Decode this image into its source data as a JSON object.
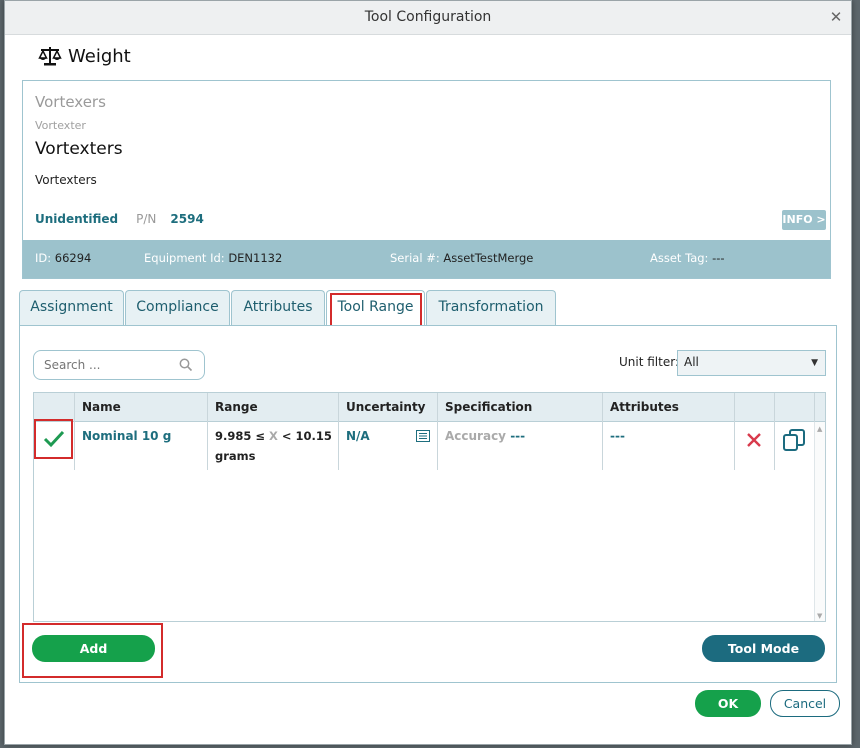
{
  "dialog": {
    "title": "Tool Configuration"
  },
  "heading": "Weight",
  "asset": {
    "manufacturer": "Vortexers",
    "manufacturer_sub": "Vortexter",
    "model": "Vortexters",
    "description": "Vortexters",
    "status": "Unidentified",
    "pn_label": "P/N",
    "pn_value": "2594",
    "info_button": "INFO >",
    "id_label": "ID:",
    "id_value": "66294",
    "equipment_label": "Equipment Id:",
    "equipment_value": "DEN1132",
    "serial_label": "Serial #:",
    "serial_value": "AssetTestMerge",
    "tag_label": "Asset Tag:",
    "tag_value": "---"
  },
  "tabs": [
    "Assignment",
    "Compliance",
    "Attributes",
    "Tool Range",
    "Transformation"
  ],
  "active_tab": "Tool Range",
  "search": {
    "placeholder": "Search ..."
  },
  "unit_filter": {
    "label": "Unit filter:",
    "value": "All"
  },
  "table": {
    "headers": [
      "Name",
      "Range",
      "Uncertainty",
      "Specification",
      "Attributes"
    ],
    "rows": [
      {
        "name": "Nominal 10 g",
        "range_low": "9.985 ≤ ",
        "range_x": "X",
        "range_high": " < 10.15",
        "range_unit": "grams",
        "uncertainty": "N/A",
        "spec_label": "Accuracy",
        "spec_value": " ---",
        "attributes": "---"
      }
    ]
  },
  "buttons": {
    "add": "Add",
    "tool_mode": "Tool Mode",
    "ok": "OK",
    "cancel": "Cancel"
  },
  "colors": {
    "teal": "#1c6b7f",
    "green": "#15a14b",
    "header_bar": "#9cc2cc",
    "highlight_red": "#d32b2b"
  }
}
